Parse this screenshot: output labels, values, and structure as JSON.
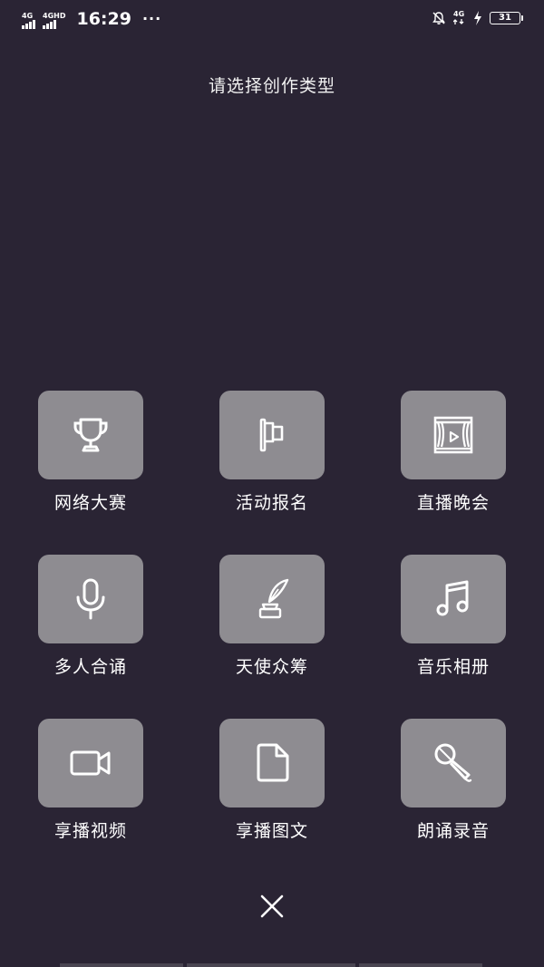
{
  "status_bar": {
    "network_1": "4G",
    "network_2": "4GHD",
    "time": "16:29",
    "more_indicator": "···",
    "network_right": "4G",
    "battery_level": "31",
    "icons": [
      "signal-bars-icon",
      "signal-bars-icon",
      "mute-bell-icon",
      "signal-4g-icon",
      "charging-bolt-icon",
      "battery-icon"
    ]
  },
  "page": {
    "title": "请选择创作类型"
  },
  "options": [
    {
      "label": "网络大赛",
      "icon": "trophy-icon"
    },
    {
      "label": "活动报名",
      "icon": "flag-icon"
    },
    {
      "label": "直播晚会",
      "icon": "stage-play-icon"
    },
    {
      "label": "多人合诵",
      "icon": "microphone-icon"
    },
    {
      "label": "天使众筹",
      "icon": "quill-ink-icon"
    },
    {
      "label": "音乐相册",
      "icon": "music-note-icon"
    },
    {
      "label": "享播视频",
      "icon": "video-camera-icon"
    },
    {
      "label": "享播图文",
      "icon": "document-icon"
    },
    {
      "label": "朗诵录音",
      "icon": "handheld-mic-icon"
    }
  ],
  "close": {
    "icon": "close-icon"
  },
  "colors": {
    "background": "#2a2434",
    "tile": "#8e8c91",
    "text": "#ffffff"
  }
}
